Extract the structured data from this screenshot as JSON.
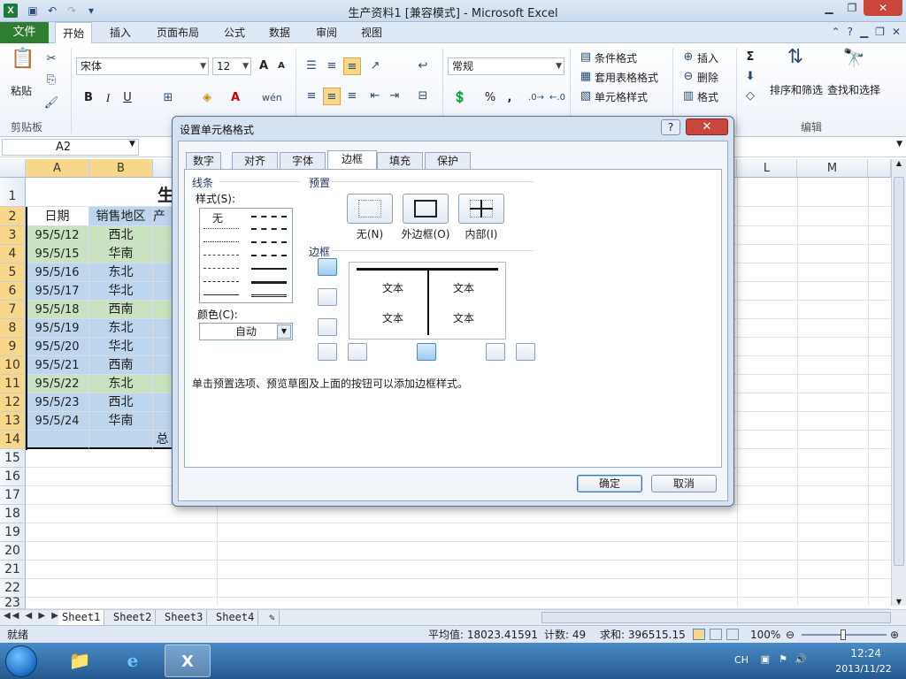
{
  "window": {
    "title": "生产资料1 [兼容模式] - Microsoft Excel",
    "app_icon": "X"
  },
  "ribbon": {
    "file_tab": "文件",
    "tabs": [
      "开始",
      "插入",
      "页面布局",
      "公式",
      "数据",
      "审阅",
      "视图"
    ],
    "clipboard": {
      "paste": "粘贴",
      "group": "剪贴板"
    },
    "font": {
      "name": "宋体",
      "size": "12",
      "bold": "B",
      "italic": "I",
      "underline": "U"
    },
    "number": {
      "format": "常规",
      "percent": "%",
      "comma": ","
    },
    "styles": {
      "conditional": "条件格式",
      "table": "套用表格格式",
      "cell": "单元格样式"
    },
    "cells": {
      "insert": "插入",
      "delete": "删除",
      "format": "格式"
    },
    "editing": {
      "sigma": "Σ",
      "sort": "排序和筛选",
      "find": "查找和选择",
      "group": "编辑"
    }
  },
  "formula_bar": {
    "name_box": "A2"
  },
  "sheet": {
    "columns": [
      "A",
      "B",
      "L",
      "M"
    ],
    "row_numbers": [
      "1",
      "2",
      "3",
      "4",
      "5",
      "6",
      "7",
      "8",
      "9",
      "10",
      "11",
      "12",
      "13",
      "14",
      "15",
      "16",
      "17",
      "18",
      "19",
      "20",
      "21",
      "22",
      "23"
    ],
    "title_fragment": "生产资",
    "headers": [
      "日期",
      "销售地区",
      "产"
    ],
    "rows": [
      {
        "date": "95/5/12",
        "region": "西北",
        "color": "green"
      },
      {
        "date": "95/5/15",
        "region": "华南",
        "color": "green"
      },
      {
        "date": "95/5/16",
        "region": "东北",
        "color": "blue"
      },
      {
        "date": "95/5/17",
        "region": "华北",
        "color": "blue"
      },
      {
        "date": "95/5/18",
        "region": "西南",
        "color": "green"
      },
      {
        "date": "95/5/19",
        "region": "东北",
        "color": "blue"
      },
      {
        "date": "95/5/20",
        "region": "华北",
        "color": "blue"
      },
      {
        "date": "95/5/21",
        "region": "西南",
        "color": "blue"
      },
      {
        "date": "95/5/22",
        "region": "东北",
        "color": "green"
      },
      {
        "date": "95/5/23",
        "region": "西北",
        "color": "blue"
      },
      {
        "date": "95/5/24",
        "region": "华南",
        "color": "blue"
      }
    ],
    "total_fragment": "总",
    "tabs": [
      "Sheet1",
      "Sheet2",
      "Sheet3",
      "Sheet4"
    ]
  },
  "status": {
    "ready": "就绪",
    "average": "平均值: 18023.41591",
    "count": "计数: 49",
    "sum": "求和: 396515.15",
    "zoom": "100%"
  },
  "taskbar": {
    "lang": "CH",
    "time": "12:24",
    "date": "2013/11/22"
  },
  "dialog": {
    "title": "设置单元格格式",
    "help": "?",
    "close": "✕",
    "tabs": [
      "数字",
      "对齐",
      "字体",
      "边框",
      "填充",
      "保护"
    ],
    "line_group": "线条",
    "style_label": "样式(S):",
    "style_none": "无",
    "color_label": "颜色(C):",
    "color_value": "自动",
    "presets_group": "预置",
    "presets": [
      "无(N)",
      "外边框(O)",
      "内部(I)"
    ],
    "border_group": "边框",
    "preview_text": [
      "文本",
      "文本",
      "文本",
      "文本"
    ],
    "hint": "单击预置选项、预览草图及上面的按钮可以添加边框样式。",
    "ok": "确定",
    "cancel": "取消"
  }
}
